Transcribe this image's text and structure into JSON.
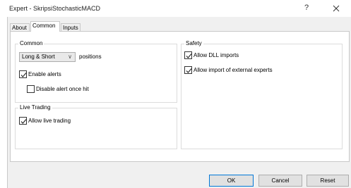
{
  "window": {
    "title": "Expert - SkripsiStochasticMACD",
    "help_label": "?"
  },
  "tabs": [
    {
      "label": "About",
      "active": false
    },
    {
      "label": "Common",
      "active": true
    },
    {
      "label": "Inputs",
      "active": false
    }
  ],
  "common": {
    "title": "Common",
    "position_select": "Long & Short",
    "position_label": "positions",
    "enable_alerts": {
      "label": "Enable alerts",
      "checked": true
    },
    "disable_alert": {
      "label": "Disable alert once hit",
      "checked": false
    }
  },
  "live_trading": {
    "title": "Live Trading",
    "allow_live": {
      "label": "Allow live trading",
      "checked": true
    }
  },
  "safety": {
    "title": "Safety",
    "allow_dll": {
      "label": "Allow DLL imports",
      "checked": true
    },
    "allow_external": {
      "label": "Allow import of external experts",
      "checked": true
    }
  },
  "buttons": {
    "ok": "OK",
    "cancel": "Cancel",
    "reset": "Reset"
  }
}
